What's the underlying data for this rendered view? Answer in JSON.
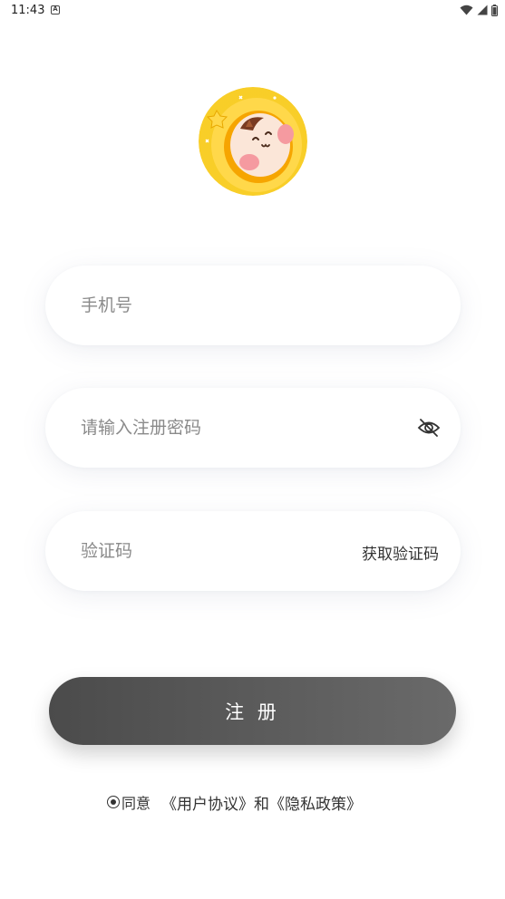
{
  "status_bar": {
    "time": "11:43",
    "notification_icon": "A",
    "icons": [
      "wifi-icon",
      "signal-icon",
      "battery-icon"
    ]
  },
  "avatar": {
    "icon": "cartoon-avatar"
  },
  "form": {
    "phone": {
      "placeholder": "手机号",
      "value": ""
    },
    "password": {
      "placeholder": "请输入注册密码",
      "value": "",
      "toggle_icon": "eye-off-icon"
    },
    "code": {
      "placeholder": "验证码",
      "value": "",
      "action_label": "获取验证码"
    }
  },
  "register_button": {
    "label": "注 册"
  },
  "agreement": {
    "prefix": "同意",
    "user_agreement": "《用户协议》",
    "conjunction": "和",
    "privacy_policy": "《隐私政策》"
  },
  "colors": {
    "button_start": "#4b4b4b",
    "button_end": "#6a6a6a",
    "avatar_yellow": "#f7c91c",
    "text": "#333333",
    "placeholder": "#8a8a8a"
  }
}
